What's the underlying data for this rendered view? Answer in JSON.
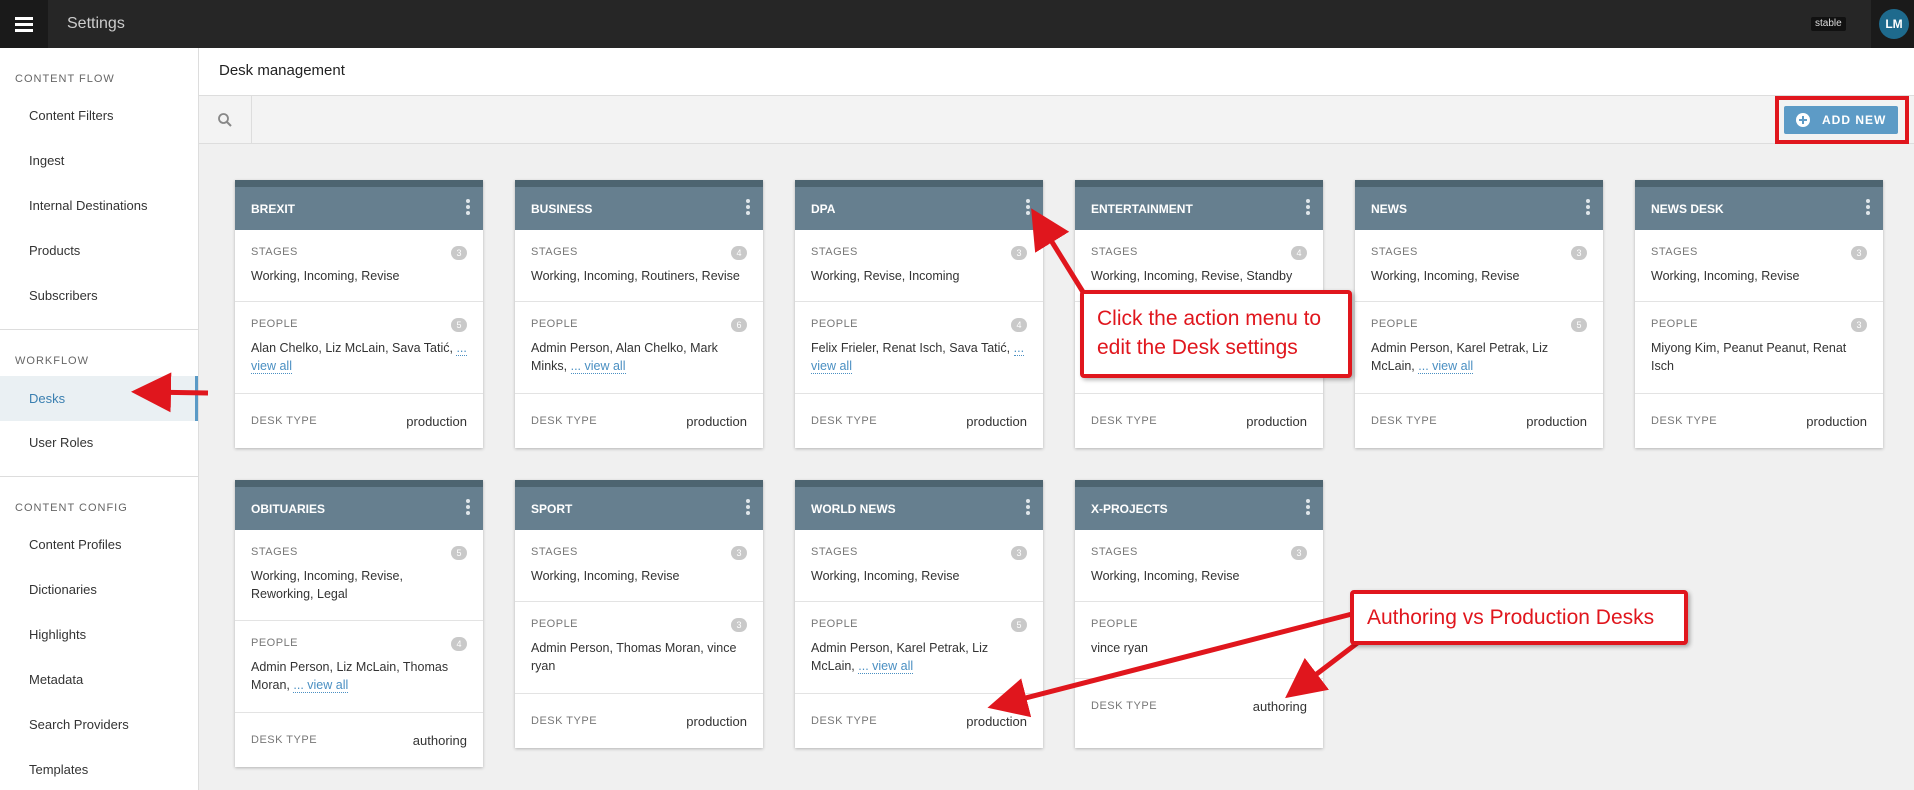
{
  "topbar": {
    "title": "Settings",
    "env_badge": "stable",
    "avatar_initials": "LM"
  },
  "sidebar": {
    "sections": [
      {
        "heading": "CONTENT FLOW",
        "items": [
          "Content Filters",
          "Ingest",
          "Internal Destinations",
          "Products",
          "Subscribers"
        ]
      },
      {
        "heading": "WORKFLOW",
        "items": [
          "Desks",
          "User Roles"
        ]
      },
      {
        "heading": "CONTENT CONFIG",
        "items": [
          "Content Profiles",
          "Dictionaries",
          "Highlights",
          "Metadata",
          "Search Providers",
          "Templates"
        ]
      }
    ],
    "active_item": "Desks"
  },
  "main": {
    "title": "Desk management",
    "add_label": "ADD NEW"
  },
  "labels": {
    "stages": "STAGES",
    "people": "PEOPLE",
    "desk_type": "DESK TYPE",
    "view_all": "... view all"
  },
  "desks": [
    {
      "name": "BREXIT",
      "stages_count": "3",
      "stages": "Working, Incoming, Revise",
      "people_count": "5",
      "people": "Alan Chelko, Liz McLain, Sava Tatić,",
      "type": "production"
    },
    {
      "name": "BUSINESS",
      "stages_count": "4",
      "stages": "Working, Incoming, Routiners, Revise",
      "people_count": "6",
      "people": "Admin Person, Alan Chelko, Mark Minks,",
      "type": "production"
    },
    {
      "name": "DPA",
      "stages_count": "3",
      "stages": "Working, Revise, Incoming",
      "people_count": "4",
      "people": "Felix Frieler, Renat Isch, Sava Tatić,",
      "type": "production"
    },
    {
      "name": "ENTERTAINMENT",
      "stages_count": "4",
      "stages": "Working, Incoming, Revise, Standby",
      "people_count": "",
      "people": "",
      "type": "production"
    },
    {
      "name": "NEWS",
      "stages_count": "3",
      "stages": "Working, Incoming, Revise",
      "people_count": "5",
      "people": "Admin Person, Karel Petrak, Liz McLain,",
      "type": "production"
    },
    {
      "name": "NEWS DESK",
      "stages_count": "3",
      "stages": "Working, Incoming, Revise",
      "people_count": "3",
      "people": "Miyong Kim, Peanut Peanut, Renat Isch",
      "type": "production"
    },
    {
      "name": "OBITUARIES",
      "stages_count": "5",
      "stages": "Working, Incoming, Revise, Reworking, Legal",
      "people_count": "4",
      "people": "Admin Person, Liz McLain, Thomas Moran,",
      "type": "authoring"
    },
    {
      "name": "SPORT",
      "stages_count": "3",
      "stages": "Working, Incoming, Revise",
      "people_count": "3",
      "people": "Admin Person, Thomas Moran, vince ryan",
      "type": "production"
    },
    {
      "name": "WORLD NEWS",
      "stages_count": "3",
      "stages": "Working, Incoming, Revise",
      "people_count": "5",
      "people": "Admin Person, Karel Petrak, Liz McLain,",
      "type": "production"
    },
    {
      "name": "X-PROJECTS",
      "stages_count": "3",
      "stages": "Working, Incoming, Revise",
      "people_count": "",
      "people": "vince ryan",
      "type": "authoring"
    }
  ],
  "annotations": {
    "action_menu": "Click the action menu to edit the Desk settings",
    "desk_types": "Authoring vs Production Desks"
  },
  "colors": {
    "annotation_red": "#e0161d",
    "card_header": "#667f8f",
    "accent_blue": "#5d9bc6"
  }
}
